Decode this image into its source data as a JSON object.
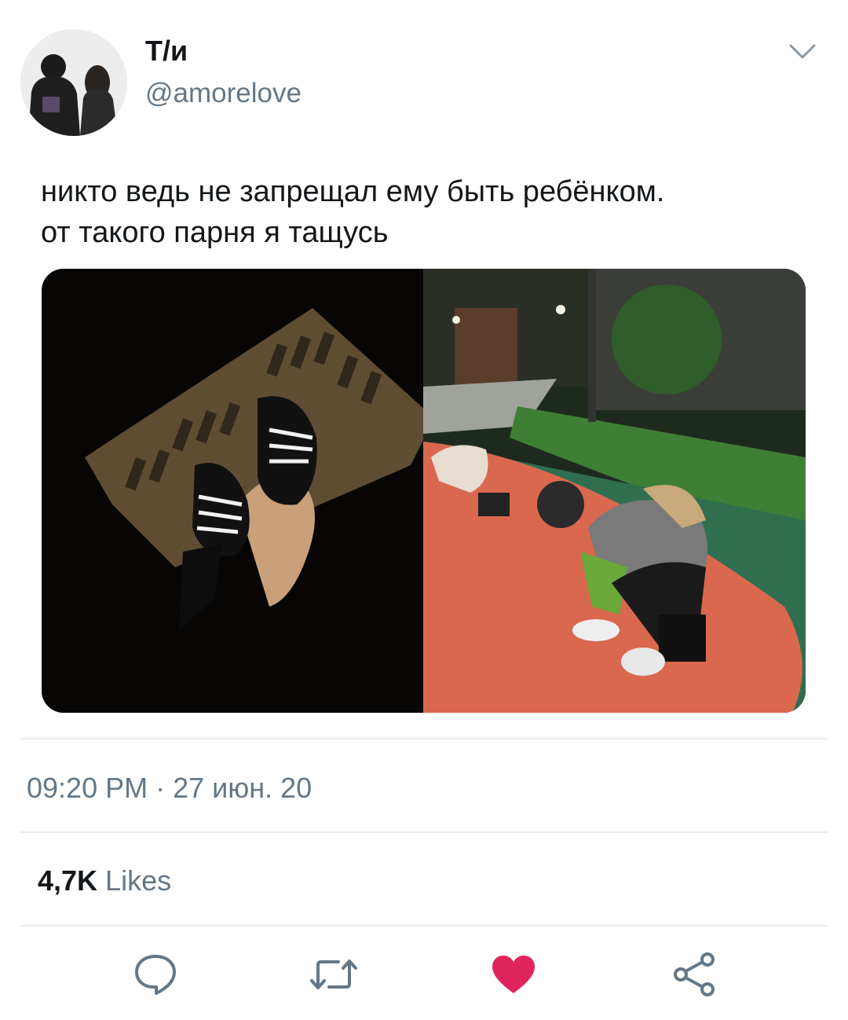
{
  "author": {
    "display_name": "Т/и",
    "handle": "@amorelove"
  },
  "tweet": {
    "text_line1": "никто ведь не запрещал ему быть ребёнком.",
    "text_line2": "от такого парня я тащусь"
  },
  "meta": {
    "time": "09:20 PM",
    "separator": " · ",
    "date": "27 июн. 20"
  },
  "stats": {
    "likes_count": "4,7K",
    "likes_label": "Likes"
  },
  "actions": [
    {
      "icon": "reply-icon"
    },
    {
      "icon": "retweet-icon"
    },
    {
      "icon": "heart-icon",
      "active": true
    },
    {
      "icon": "share-icon"
    }
  ],
  "colors": {
    "text": "#14171a",
    "secondary": "#657786",
    "like_active": "#e0245e",
    "divider": "#e6ecf0"
  }
}
